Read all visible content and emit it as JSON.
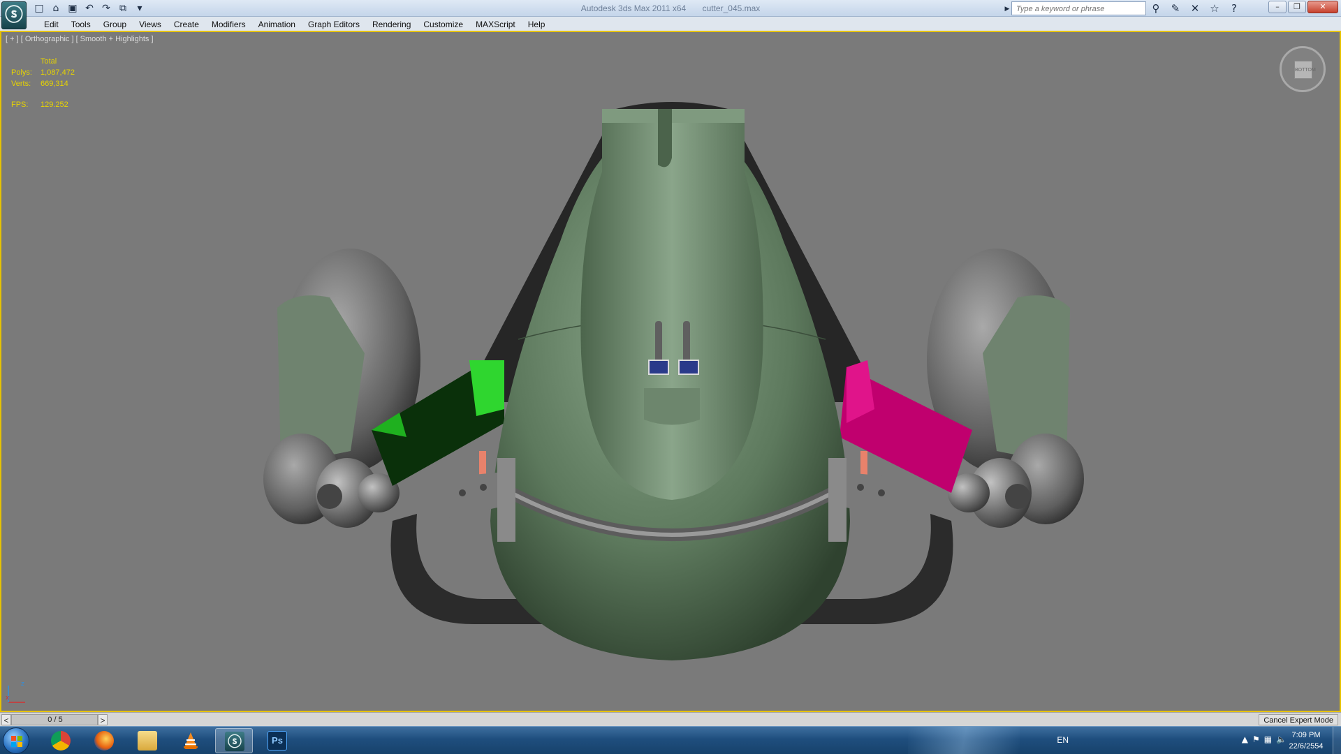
{
  "window": {
    "title_app": "Autodesk 3ds Max  2011 x64",
    "title_file": "cutter_045.max",
    "search_placeholder": "Type a keyword or phrase"
  },
  "menu": [
    "Edit",
    "Tools",
    "Group",
    "Views",
    "Create",
    "Modifiers",
    "Animation",
    "Graph Editors",
    "Rendering",
    "Customize",
    "MAXScript",
    "Help"
  ],
  "viewport": {
    "label": "[ + ] [ Orthographic ] [ Smooth + Highlights ]",
    "stats": {
      "header": "Total",
      "polys_label": "Polys:",
      "polys_value": "1,087,472",
      "verts_label": "Verts:",
      "verts_value": "669,314",
      "fps_label": "FPS:",
      "fps_value": "129.252"
    },
    "viewcube_face": "BOTTOM",
    "axis_x": "x",
    "axis_z": "z"
  },
  "timeline": {
    "frame": "0 / 5",
    "prev": "<",
    "next": ">",
    "position": 0
  },
  "status": {
    "expert_button": "Cancel Expert Mode"
  },
  "taskbar": {
    "language": "EN",
    "time": "7:09 PM",
    "date": "22/6/2554",
    "apps": [
      "chrome-icon",
      "firefox-icon",
      "explorer-icon",
      "vlc-icon",
      "3dsmax-icon",
      "photoshop-icon"
    ],
    "photoshop_label": "Ps"
  },
  "colors": {
    "viewport_bg": "#7a7a7a",
    "active_border": "#e6c200",
    "stats_text": "#e8d400",
    "hull": "#5f7a5f",
    "green_arm": "#2fd62f",
    "magenta_arm": "#c0006e"
  }
}
